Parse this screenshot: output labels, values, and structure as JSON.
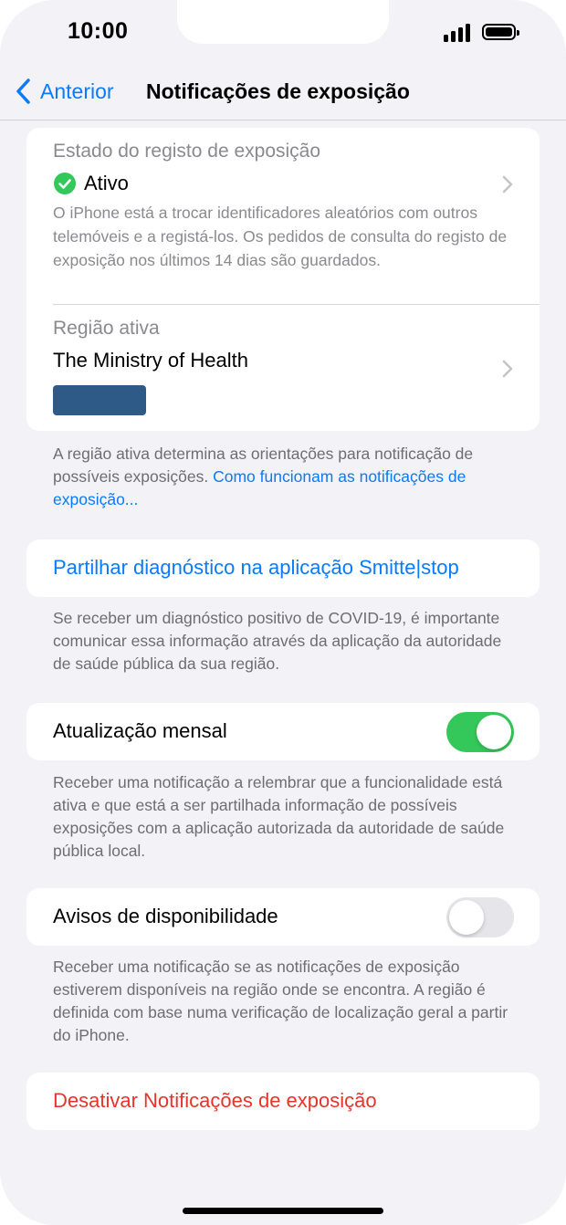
{
  "status_bar": {
    "time": "10:00"
  },
  "nav": {
    "back_label": "Anterior",
    "title": "Notificações de exposição"
  },
  "exposure_state": {
    "heading": "Estado do registo de exposição",
    "status": "Ativo",
    "description": "O iPhone está a trocar identificadores aleatórios com outros telemóveis e a registá-los. Os pedidos de consulta do registo de exposição nos últimos 14 dias são guardados."
  },
  "active_region": {
    "heading": "Região ativa",
    "name": "The Ministry of Health"
  },
  "region_footer": {
    "text": "A região ativa determina as orientações para notificação de possíveis exposições. ",
    "link": "Como funcionam as notificações de exposição..."
  },
  "share": {
    "label": "Partilhar diagnóstico na aplicação Smitte|stop",
    "footer": "Se receber um diagnóstico positivo de COVID-19, é importante comunicar essa informação através da aplicação da autoridade de saúde pública da sua região."
  },
  "monthly_update": {
    "label": "Atualização mensal",
    "enabled": true,
    "footer": "Receber uma notificação a relembrar que a funcionalidade está ativa e que está a ser partilhada informação de possíveis exposições com a aplicação autorizada da autoridade de saúde pública local."
  },
  "availability_alerts": {
    "label": "Avisos de disponibilidade",
    "enabled": false,
    "footer": "Receber uma notificação se as notificações de exposição estiverem disponíveis na região onde se encontra. A região é definida com base numa verificação de localização geral a partir do iPhone."
  },
  "disable": {
    "label": "Desativar Notificações de exposição"
  },
  "colors": {
    "accent": "#0a7aff",
    "toggle_on": "#34c759",
    "status_ok": "#34c759",
    "danger": "#e5352b",
    "redacted_block": "#2d5a87"
  },
  "icons": {
    "back": "chevron-left-icon",
    "status": "checkmark-circle-icon",
    "disclosure": "chevron-right-icon"
  }
}
